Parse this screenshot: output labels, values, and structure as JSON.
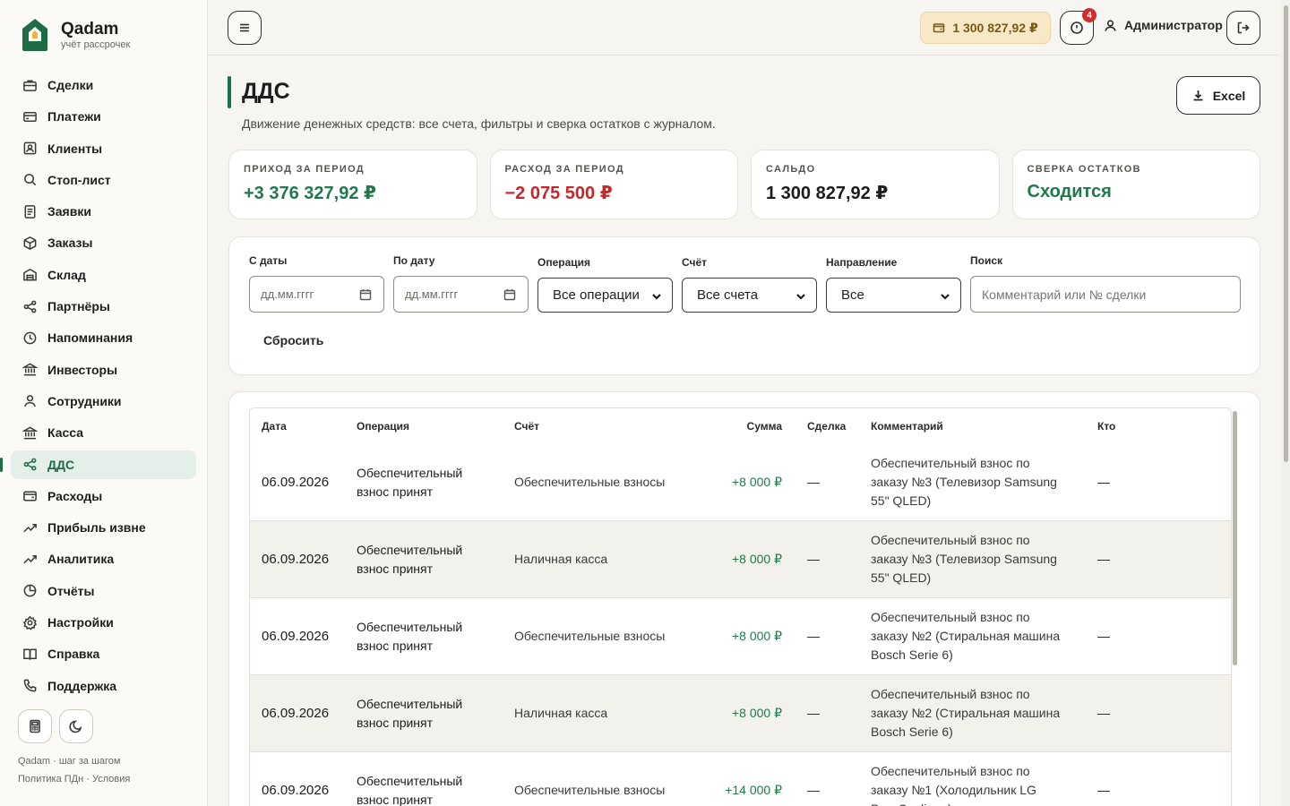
{
  "brand": {
    "name": "Qadam",
    "subtitle": "учёт рассрочек"
  },
  "sidebar": {
    "items": [
      {
        "label": "Сделки",
        "icon": "briefcase-icon"
      },
      {
        "label": "Платежи",
        "icon": "credit-card-icon"
      },
      {
        "label": "Клиенты",
        "icon": "user-card-icon"
      },
      {
        "label": "Стоп-лист",
        "icon": "search-icon"
      },
      {
        "label": "Заявки",
        "icon": "document-icon"
      },
      {
        "label": "Заказы",
        "icon": "package-icon"
      },
      {
        "label": "Склад",
        "icon": "warehouse-icon"
      },
      {
        "label": "Партнёры",
        "icon": "share-icon"
      },
      {
        "label": "Напоминания",
        "icon": "clock-icon"
      },
      {
        "label": "Инвесторы",
        "icon": "bank-icon"
      },
      {
        "label": "Сотрудники",
        "icon": "user-icon"
      },
      {
        "label": "Касса",
        "icon": "bank-icon"
      },
      {
        "label": "ДДС",
        "icon": "share-icon",
        "active": true
      },
      {
        "label": "Расходы",
        "icon": "wallet-icon"
      },
      {
        "label": "Прибыль извне",
        "icon": "trend-up-icon"
      },
      {
        "label": "Аналитика",
        "icon": "trend-up-icon"
      },
      {
        "label": "Отчёты",
        "icon": "pie-chart-icon"
      },
      {
        "label": "Настройки",
        "icon": "gear-icon"
      },
      {
        "label": "Справка",
        "icon": "book-icon"
      },
      {
        "label": "Поддержка",
        "icon": "phone-icon"
      }
    ],
    "tools": [
      "calculator-icon",
      "moon-icon"
    ],
    "footer_line1": "Qadam · шаг за шагом",
    "footer_line2": "Политика ПДн · Условия"
  },
  "topbar": {
    "balance": "1 300 827,92 ₽",
    "alerts_count": "4",
    "user": "Администратор"
  },
  "page": {
    "title": "ДДС",
    "subtitle": "Движение денежных средств: все счета, фильтры и сверка остатков с журналом.",
    "export_label": "Excel"
  },
  "stats": [
    {
      "label": "ПРИХОД ЗА ПЕРИОД",
      "value": "+3 376 327,92 ₽",
      "color": "#1f7a4a"
    },
    {
      "label": "РАСХОД ЗА ПЕРИОД",
      "value": "−2 075 500 ₽",
      "color": "#c8262b"
    },
    {
      "label": "САЛЬДО",
      "value": "1 300 827,92 ₽",
      "color": "#1d1d1b"
    },
    {
      "label": "СВЕРКА ОСТАТКОВ",
      "value": "Сходится",
      "color": "#1f7a4a"
    }
  ],
  "filters": {
    "from_label": "С даты",
    "from_placeholder": "дд.мм.гггг",
    "to_label": "По дату",
    "to_placeholder": "дд.мм.гггг",
    "operation_label": "Операция",
    "operation_value": "Все операции",
    "account_label": "Счёт",
    "account_value": "Все счета",
    "direction_label": "Направление",
    "direction_value": "Все",
    "search_label": "Поиск",
    "search_placeholder": "Комментарий или № сделки",
    "reset_label": "Сбросить"
  },
  "table": {
    "columns": [
      "Дата",
      "Операция",
      "Счёт",
      "Сумма",
      "Сделка",
      "Комментарий",
      "Кто"
    ],
    "rows": [
      {
        "date": "06.09.2026",
        "op1": "Обеспечительный",
        "op2": "взнос принят",
        "account": "Обеспечительные взносы",
        "amount": "+8 000 ₽",
        "deal": "—",
        "c1": "Обеспечительный взнос по",
        "c2": "заказу №3 (Телевизор Samsung",
        "c3": "55\" QLED)",
        "who": "—"
      },
      {
        "date": "06.09.2026",
        "op1": "Обеспечительный",
        "op2": "взнос принят",
        "account": "Наличная касса",
        "amount": "+8 000 ₽",
        "deal": "—",
        "c1": "Обеспечительный взнос по",
        "c2": "заказу №3 (Телевизор Samsung",
        "c3": "55\" QLED)",
        "who": "—"
      },
      {
        "date": "06.09.2026",
        "op1": "Обеспечительный",
        "op2": "взнос принят",
        "account": "Обеспечительные взносы",
        "amount": "+8 000 ₽",
        "deal": "—",
        "c1": "Обеспечительный взнос по",
        "c2": "заказу №2 (Стиральная машина",
        "c3": "Bosch Serie 6)",
        "who": "—"
      },
      {
        "date": "06.09.2026",
        "op1": "Обеспечительный",
        "op2": "взнос принят",
        "account": "Наличная касса",
        "amount": "+8 000 ₽",
        "deal": "—",
        "c1": "Обеспечительный взнос по",
        "c2": "заказу №2 (Стиральная машина",
        "c3": "Bosch Serie 6)",
        "who": "—"
      },
      {
        "date": "06.09.2026",
        "op1": "Обеспечительный",
        "op2": "взнос принят",
        "account": "Обеспечительные взносы",
        "amount": "+14 000 ₽",
        "deal": "—",
        "c1": "Обеспечительный взнос по",
        "c2": "заказу №1 (Холодильник LG",
        "c3": "DoorCooling+)",
        "who": "—"
      }
    ]
  }
}
